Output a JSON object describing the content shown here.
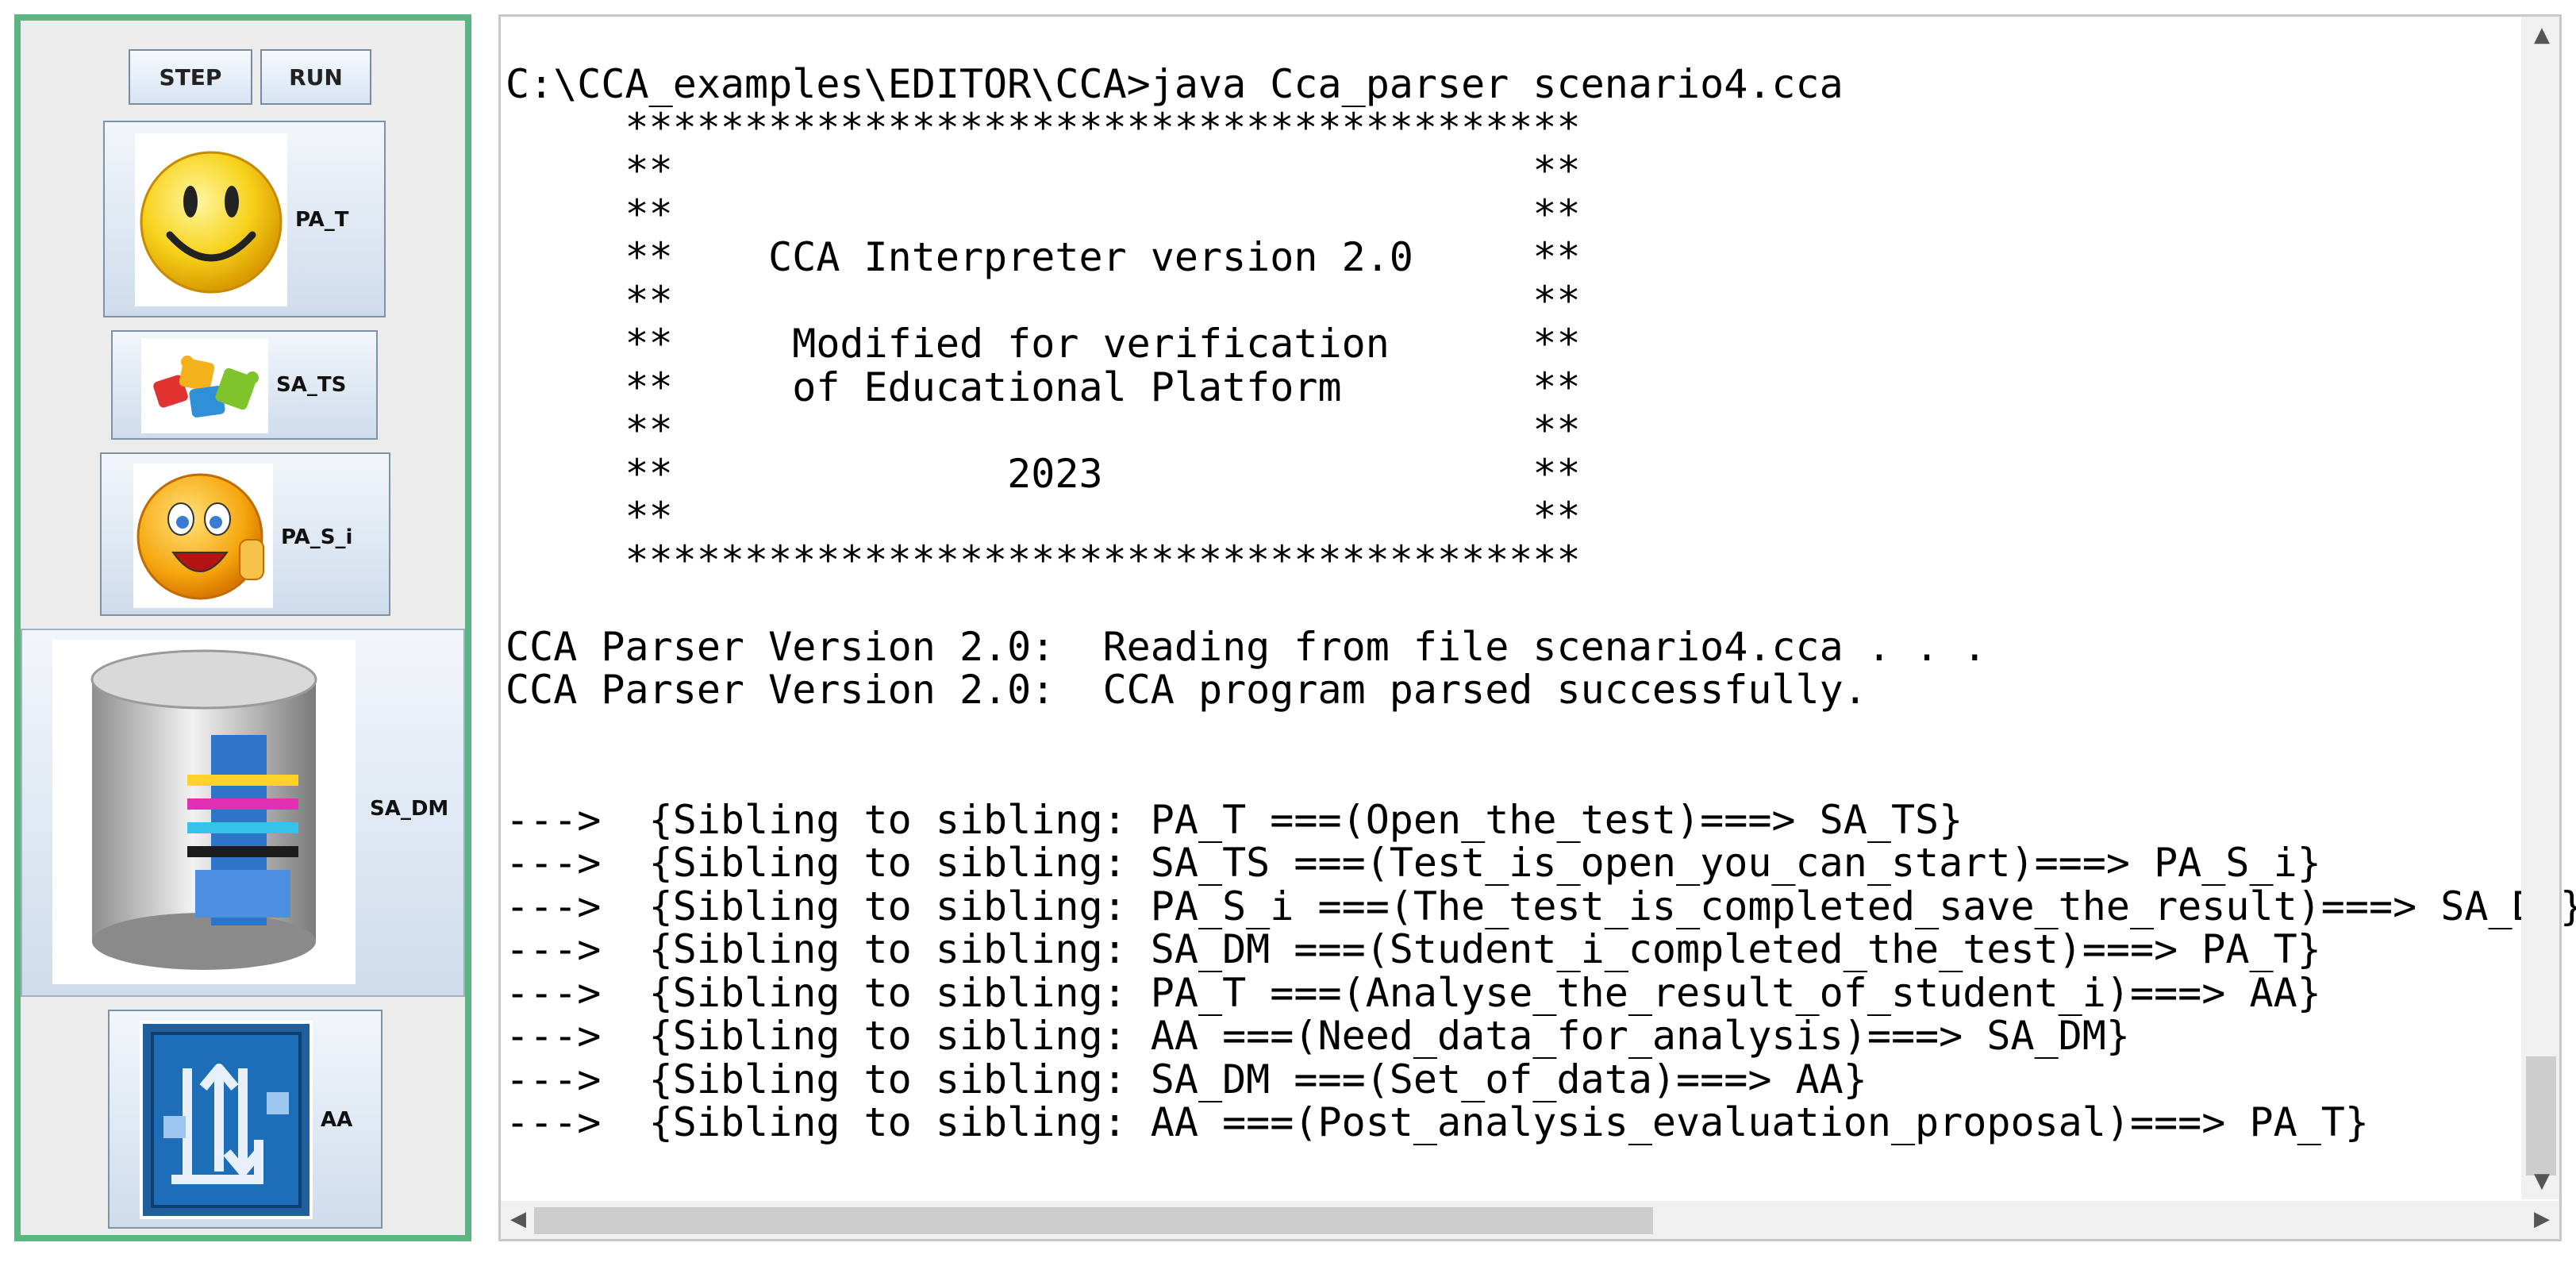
{
  "toolbar": {
    "step_label": "STEP",
    "run_label": "RUN"
  },
  "agents": [
    {
      "label": "PA_T",
      "icon": "smiley-face-icon"
    },
    {
      "label": "SA_TS",
      "icon": "puzzle-pieces-icon"
    },
    {
      "label": "PA_S_i",
      "icon": "thumbs-up-smiley-icon"
    },
    {
      "label": "SA_DM",
      "icon": "database-icon"
    },
    {
      "label": "AA",
      "icon": "data-transfer-icon"
    }
  ],
  "console": {
    "lines": [
      "C:\\CCA_examples\\EDITOR\\CCA>java Cca_parser scenario4.cca",
      "     ****************************************",
      "     **                                    **",
      "     **                                    **",
      "     **    CCA Interpreter version 2.0     **",
      "     **                                    **",
      "     **     Modified for verification      **",
      "     **     of Educational Platform        **",
      "     **                                    **",
      "     **              2023                  **",
      "     **                                    **",
      "     ****************************************",
      "",
      "CCA Parser Version 2.0:  Reading from file scenario4.cca . . .",
      "CCA Parser Version 2.0:  CCA program parsed successfully.",
      "",
      "",
      "--->  {Sibling to sibling: PA_T ===(Open_the_test)===> SA_TS}",
      "--->  {Sibling to sibling: SA_TS ===(Test_is_open_you_can_start)===> PA_S_i}",
      "--->  {Sibling to sibling: PA_S_i ===(The_test_is_completed_save_the_result)===> SA_DM}",
      "--->  {Sibling to sibling: SA_DM ===(Student_i_completed_the_test)===> PA_T}",
      "--->  {Sibling to sibling: PA_T ===(Analyse_the_result_of_student_i)===> AA}",
      "--->  {Sibling to sibling: AA ===(Need_data_for_analysis)===> SA_DM}",
      "--->  {Sibling to sibling: SA_DM ===(Set_of_data)===> AA}",
      "--->  {Sibling to sibling: AA ===(Post_analysis_evaluation_proposal)===> PA_T}"
    ]
  }
}
